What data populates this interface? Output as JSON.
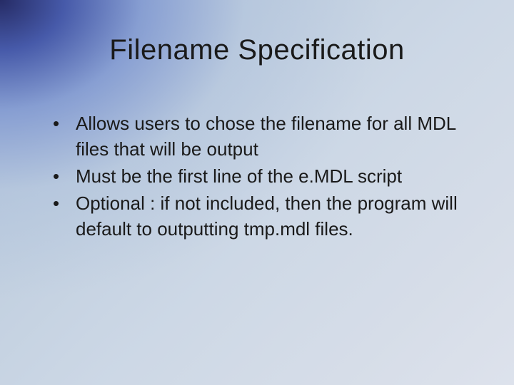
{
  "slide": {
    "title": "Filename Specification",
    "bullets": [
      "Allows users to chose the filename for all MDL files that will be output",
      "Must be the first line of the e.MDL script",
      "Optional : if not included, then the program will default to outputting tmp.mdl files."
    ],
    "bullet_char": "•"
  }
}
